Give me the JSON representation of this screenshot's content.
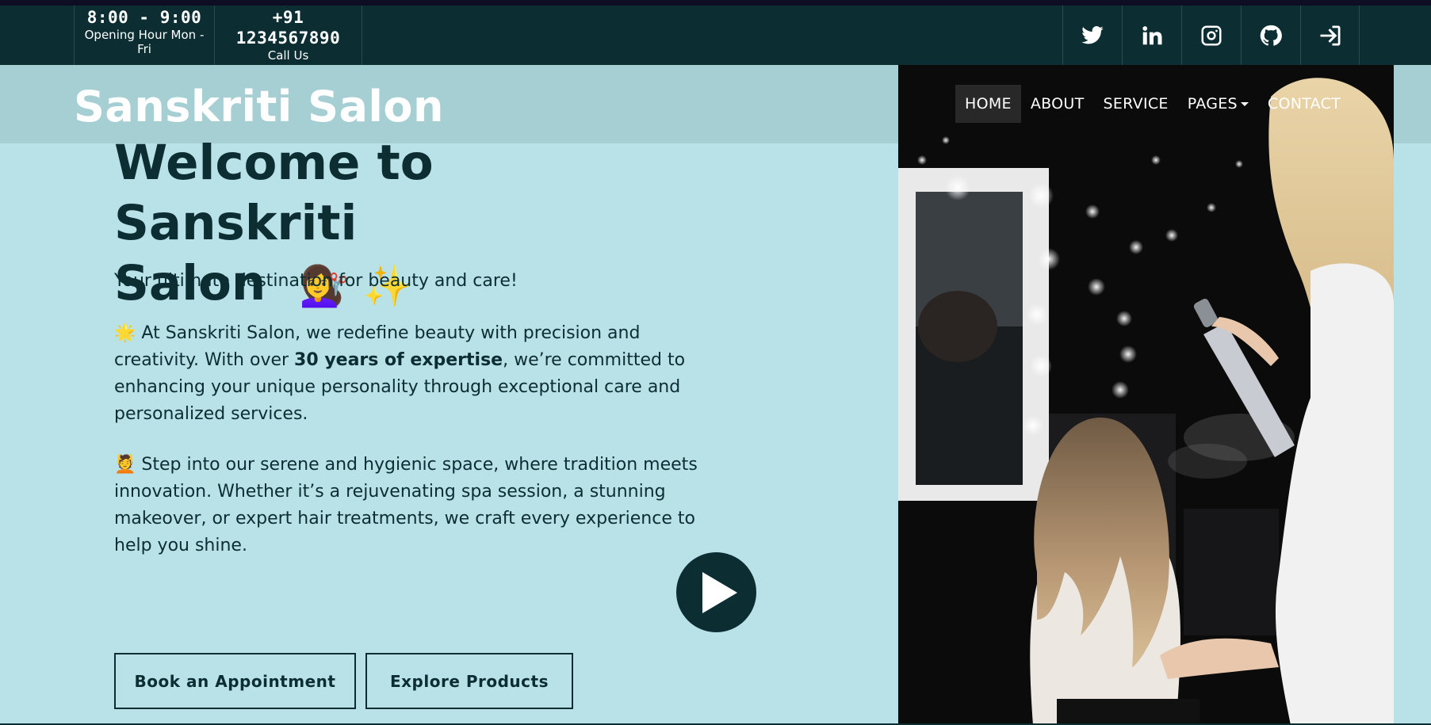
{
  "topbar": {
    "hours": "8:00 - 9:00",
    "hours_label": "Opening Hour Mon - Fri",
    "phone": "+91 1234567890",
    "phone_label": "Call Us",
    "social": [
      "twitter-icon",
      "linkedin-icon",
      "instagram-icon",
      "github-icon",
      "login-icon"
    ]
  },
  "brand": {
    "name": "Sanskriti Salon"
  },
  "nav": {
    "items": [
      "HOME",
      "ABOUT",
      "SERVICE",
      "PAGES",
      "CONTACT"
    ],
    "active": "HOME"
  },
  "hero": {
    "title_line1": "Welcome to Sanskriti",
    "title_line2": "Salon",
    "title_emoji": "💇‍♀️ ✨",
    "tagline": "Your ultimate destination for beauty and care!",
    "para1_icon": "🌟",
    "para1_a": "At Sanskriti Salon, we redefine beauty with precision and creativity. With over ",
    "para1_bold": "30 years of expertise",
    "para1_b": ", we’re committed to enhancing your unique personality through exceptional care and personalized services.",
    "para2_icon": "💆",
    "para2": "Step into our serene and hygienic space, where tradition meets innovation. Whether it’s a rejuvenating spa session, a stunning makeover, or expert hair treatments, we craft every experience to help you shine.",
    "cta_primary": "Book an Appointment",
    "cta_secondary": "Explore Products"
  },
  "colors": {
    "dark": "#0c2e33",
    "hero_bg": "#b8e2e8",
    "header_band": "#a6cfd4"
  }
}
